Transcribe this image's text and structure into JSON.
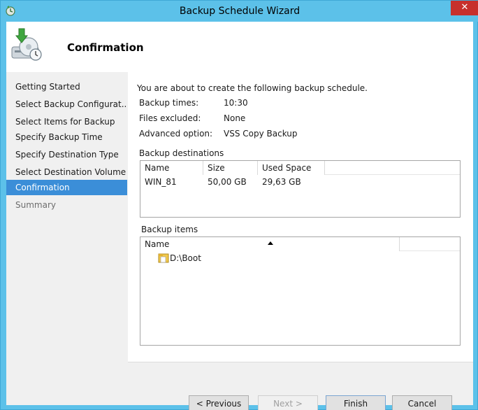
{
  "window": {
    "title": "Backup Schedule Wizard",
    "close_label": "✕"
  },
  "header": {
    "title": "Confirmation"
  },
  "sidebar": {
    "items": [
      {
        "label": "Getting Started",
        "state": "normal"
      },
      {
        "label": "Select Backup Configurat...",
        "state": "normal"
      },
      {
        "label": "Select Items for Backup",
        "state": "normal"
      },
      {
        "label": "Specify Backup Time",
        "state": "normal"
      },
      {
        "label": "Specify Destination Type",
        "state": "normal"
      },
      {
        "label": "Select Destination Volume",
        "state": "normal"
      },
      {
        "label": "Confirmation",
        "state": "active"
      },
      {
        "label": "Summary",
        "state": "disabled"
      }
    ]
  },
  "content": {
    "intro": "You are about to create the following backup schedule.",
    "details": [
      {
        "label": "Backup times:",
        "value": "10:30"
      },
      {
        "label": "Files excluded:",
        "value": "None"
      },
      {
        "label": "Advanced option:",
        "value": "VSS Copy Backup"
      }
    ],
    "destinations": {
      "label": "Backup destinations",
      "columns": [
        "Name",
        "Size",
        "Used Space"
      ],
      "rows": [
        [
          "WIN_81",
          "50,00 GB",
          "29,63 GB"
        ]
      ]
    },
    "items": {
      "label": "Backup items",
      "columns": [
        "Name"
      ],
      "rows": [
        "D:\\Boot"
      ]
    }
  },
  "buttons": {
    "previous": "< Previous",
    "next": "Next >",
    "finish": "Finish",
    "cancel": "Cancel"
  },
  "colors": {
    "titlebar": "#5cc1e9",
    "active_nav": "#3b8ed8",
    "close_button": "#c7302c"
  },
  "icons": {
    "app": "backup-clock-icon",
    "header": "backup-drive-icon",
    "folder": "folder-icon"
  }
}
